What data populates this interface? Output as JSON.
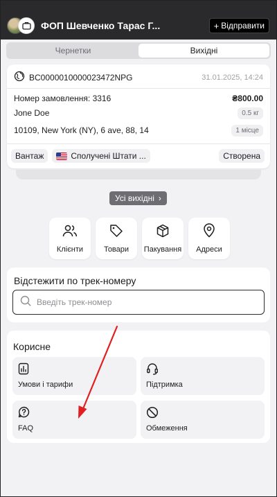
{
  "header": {
    "org_name": "ФОП Шевченко Тарас Г...",
    "send_label": "Відправити",
    "send_icon": "plus-icon",
    "badge_icon": "briefcase-icon"
  },
  "tabs": [
    {
      "label": "Чернетки",
      "active": false
    },
    {
      "label": "Вихідні",
      "active": true
    }
  ],
  "shipment": {
    "tracking_number": "BC0000010000023472NPG",
    "datetime": "31.01.2025, 14:24",
    "order_label": "Номер замовлення: 3316",
    "amount": "₴800.00",
    "recipient": "Jone Doe",
    "weight": "0.5 кг",
    "address": "10109, New York (NY), 6 ave, 88, 14",
    "places": "1 місце",
    "type_tag": "Вантаж",
    "country_tag": "Сполучені Штати ...",
    "status_tag": "Створена"
  },
  "all_outgoing_label": "Усі вихідні",
  "quick_actions": [
    {
      "label": "Клієнти",
      "icon": "users-icon"
    },
    {
      "label": "Товари",
      "icon": "tag-icon"
    },
    {
      "label": "Пакування",
      "icon": "box-icon"
    },
    {
      "label": "Адреси",
      "icon": "map-pin-icon"
    }
  ],
  "tracking": {
    "title": "Відстежити по трек-номеру",
    "placeholder": "Введіть трек-номер"
  },
  "useful": {
    "title": "Корисне",
    "tiles": [
      {
        "label": "Умови і тарифи",
        "icon": "chart-doc-icon"
      },
      {
        "label": "Підтримка",
        "icon": "headset-icon"
      },
      {
        "label": "FAQ",
        "icon": "help-circle-icon"
      },
      {
        "label": "Обмеження",
        "icon": "ban-icon"
      }
    ]
  },
  "colors": {
    "header_bg": "#2a2a2c",
    "page_bg": "#f2f2f4",
    "annotation_arrow": "#e02020"
  }
}
